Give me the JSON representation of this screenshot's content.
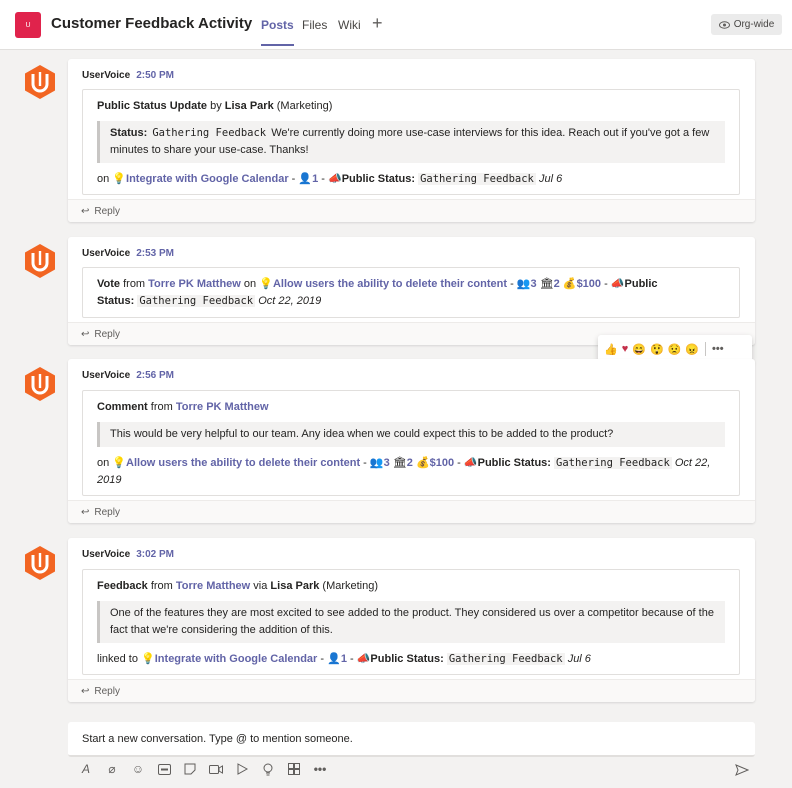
{
  "header": {
    "team_initial": "U",
    "channel_title": "Customer Feedback Activity",
    "tabs": [
      "Posts",
      "Files",
      "Wiki"
    ],
    "add_tab": "+",
    "org_badge": "Org-wide"
  },
  "colors": {
    "accent": "#6264a7",
    "team_tile": "#e0234c",
    "uservoice_orange": "#f26522"
  },
  "messages": [
    {
      "sender": "UserVoice",
      "time": "2:50 PM",
      "action": "Public Status Update",
      "by": "by",
      "user": "Lisa Park",
      "dept": "(Marketing)",
      "quote_label": "Status:",
      "quote_status": "Gathering Feedback",
      "quote_text": "We're currently doing more use-case interviews for this idea. Reach out if you've got a few minutes to share your use-case. Thanks!",
      "footer_prefix": "on",
      "idea": "Integrate with Google Calendar",
      "voters": "1",
      "status_label": "Public Status:",
      "status": "Gathering Feedback",
      "date": "Jul 6",
      "reply": "Reply"
    },
    {
      "sender": "UserVoice",
      "time": "2:53 PM",
      "action": "Vote",
      "from": "from",
      "user": "Torre PK Matthew",
      "on": "on",
      "idea": "Allow users the ability to delete their content",
      "voters": "3",
      "weight": "2",
      "money": "$100",
      "status_label_1": "Public",
      "status_label_2": "Status:",
      "status": "Gathering Feedback",
      "date": "Oct 22, 2019",
      "reply": "Reply"
    },
    {
      "sender": "UserVoice",
      "time": "2:56 PM",
      "action": "Comment",
      "from": "from",
      "user": "Torre PK Matthew",
      "quote_text": "This would be very helpful to our team. Any idea when we could expect this to be added to the product?",
      "footer_prefix": "on",
      "idea": "Allow users the ability to delete their content",
      "voters": "3",
      "weight": "2",
      "money": "$100",
      "status_label": "Public Status:",
      "status": "Gathering Feedback",
      "date": "Oct 22, 2019",
      "reply": "Reply"
    },
    {
      "sender": "UserVoice",
      "time": "3:02 PM",
      "action": "Feedback",
      "from": "from",
      "user": "Torre Matthew",
      "via": "via",
      "via_user": "Lisa Park",
      "dept": "(Marketing)",
      "quote_text": "One of the features they are most excited to see added to the product. They considered us over a competitor because of the fact that we're considering the addition of this.",
      "footer_prefix": "linked to",
      "idea": "Integrate with Google Calendar",
      "voters": "1",
      "status_label": "Public Status:",
      "status": "Gathering Feedback",
      "date": "Jul 6",
      "reply": "Reply"
    }
  ],
  "reactions": [
    "like-icon",
    "heart-icon",
    "laugh-icon",
    "surprised-icon",
    "sad-icon",
    "angry-icon"
  ],
  "compose": {
    "placeholder": "Start a new conversation. Type @ to mention someone.",
    "toolbar": [
      "format-icon",
      "attach-icon",
      "emoji-icon",
      "gif-icon",
      "sticker-icon",
      "meet-icon",
      "stream-icon",
      "praise-icon",
      "apps-icon",
      "more-icon"
    ]
  }
}
